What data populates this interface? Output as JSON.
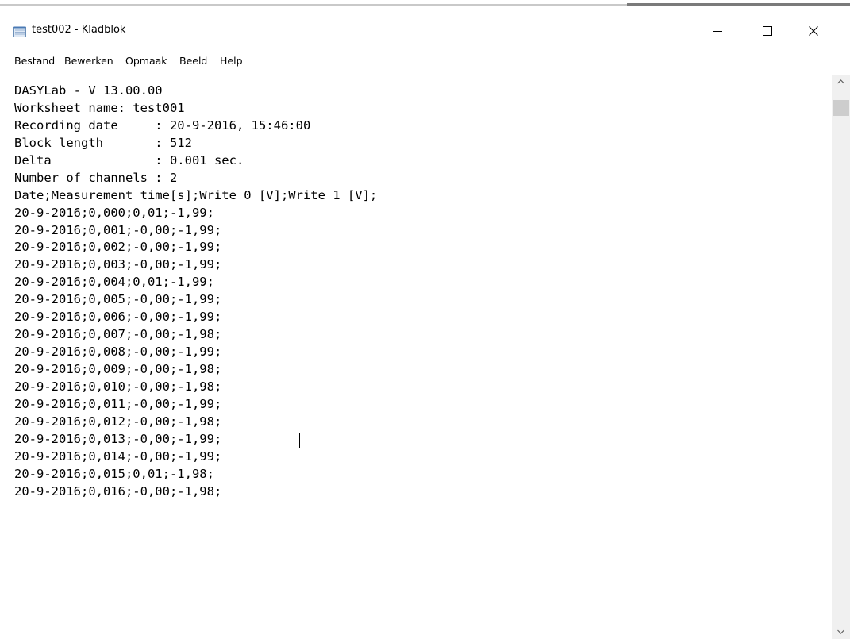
{
  "window": {
    "title": "test002 - Kladblok",
    "icon": "notepad-icon"
  },
  "caption_buttons": {
    "minimize": "minimize-icon",
    "maximize": "maximize-icon",
    "close": "close-icon"
  },
  "menu": {
    "items": [
      "Bestand",
      "Bewerken",
      "Opmaak",
      "Beeld",
      "Help"
    ]
  },
  "editor": {
    "lines": [
      "DASYLab - V 13.00.00",
      "Worksheet name: test001",
      "Recording date     : 20-9-2016, 15:46:00",
      "Block length       : 512",
      "Delta              : 0.001 sec.",
      "Number of channels : 2",
      "Date;Measurement time[s];Write 0 [V];Write 1 [V];",
      "20-9-2016;0,000;0,01;-1,99;",
      "20-9-2016;0,001;-0,00;-1,99;",
      "20-9-2016;0,002;-0,00;-1,99;",
      "20-9-2016;0,003;-0,00;-1,99;",
      "20-9-2016;0,004;0,01;-1,99;",
      "20-9-2016;0,005;-0,00;-1,99;",
      "20-9-2016;0,006;-0,00;-1,99;",
      "20-9-2016;0,007;-0,00;-1,98;",
      "20-9-2016;0,008;-0,00;-1,99;",
      "20-9-2016;0,009;-0,00;-1,98;",
      "20-9-2016;0,010;-0,00;-1,98;",
      "20-9-2016;0,011;-0,00;-1,99;",
      "20-9-2016;0,012;-0,00;-1,98;",
      "20-9-2016;0,013;-0,00;-1,99;",
      "20-9-2016;0,014;-0,00;-1,99;",
      "20-9-2016;0,015;0,01;-1,98;",
      "20-9-2016;0,016;-0,00;-1,98;"
    ]
  },
  "scrollbar": {
    "up_icon": "chevron-up-icon",
    "down_icon": "chevron-down-icon"
  },
  "colors": {
    "text": "#000000",
    "background": "#ffffff",
    "scrollbar_track": "#f0f0f0",
    "scrollbar_thumb": "#cdcdcd"
  }
}
